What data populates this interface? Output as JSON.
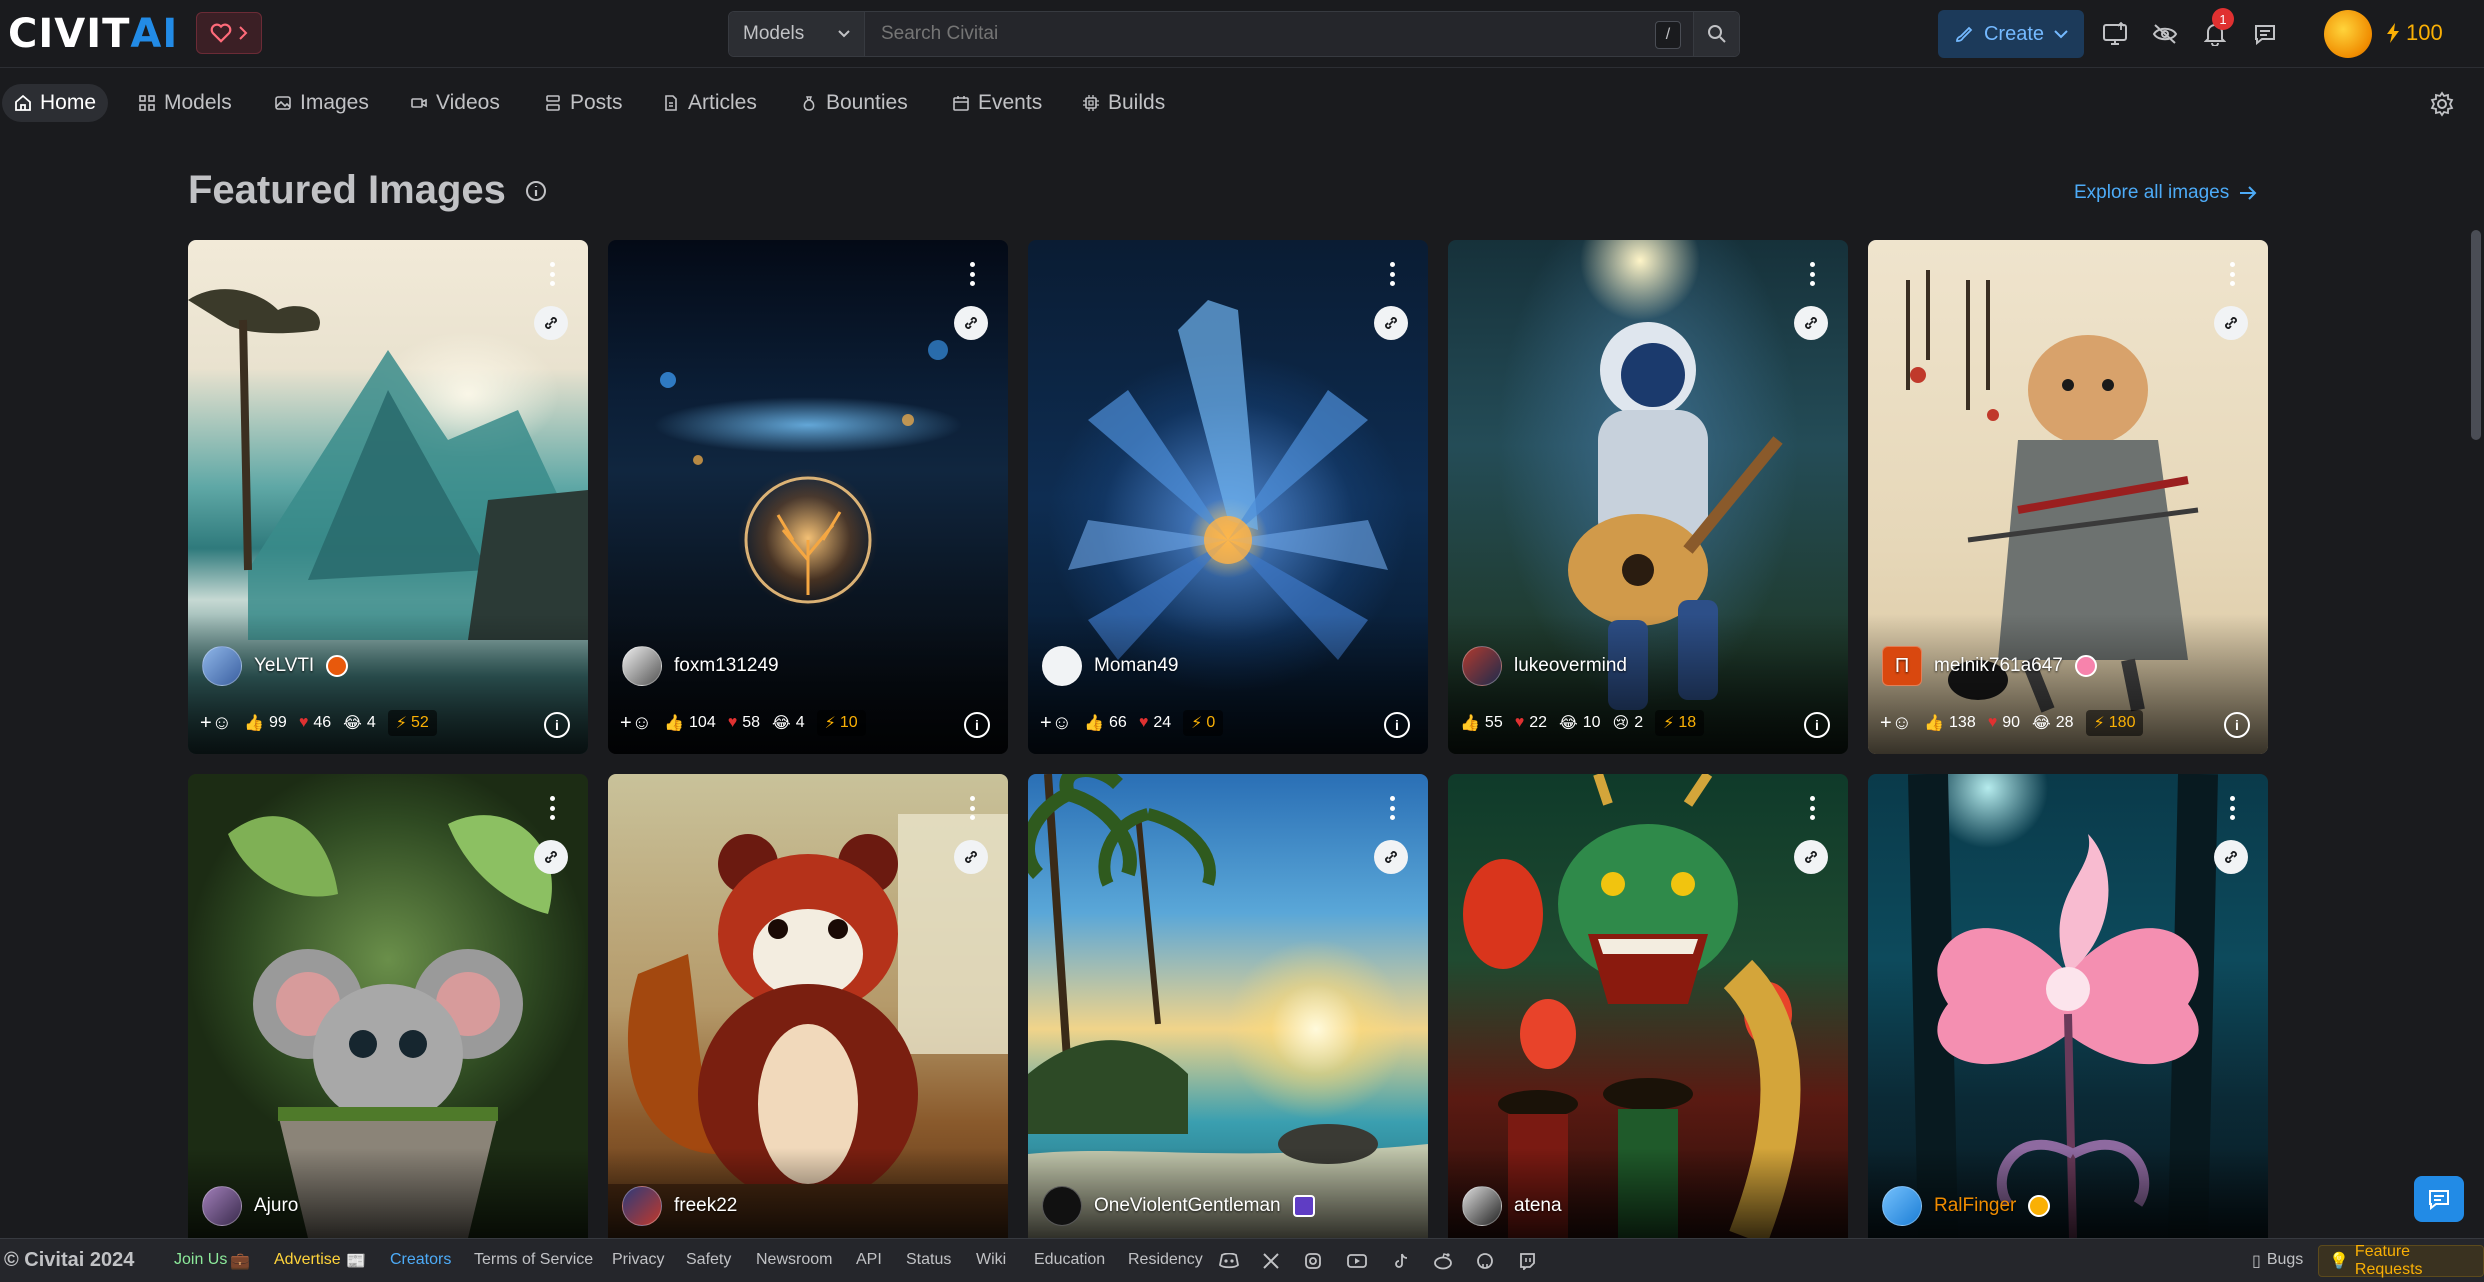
{
  "brand": {
    "part1": "CIVIT",
    "part2": "AI"
  },
  "header": {
    "search_category": "Models",
    "search_placeholder": "Search Civitai",
    "search_shortcut": "/",
    "create_label": "Create",
    "notification_count": "1",
    "buzz_amount": "100"
  },
  "nav": {
    "items": [
      {
        "label": "Home",
        "icon": "home-icon"
      },
      {
        "label": "Models",
        "icon": "grid-icon"
      },
      {
        "label": "Images",
        "icon": "photo-icon"
      },
      {
        "label": "Videos",
        "icon": "video-icon"
      },
      {
        "label": "Posts",
        "icon": "posts-icon"
      },
      {
        "label": "Articles",
        "icon": "article-icon"
      },
      {
        "label": "Bounties",
        "icon": "moneybag-icon"
      },
      {
        "label": "Events",
        "icon": "calendar-icon"
      },
      {
        "label": "Builds",
        "icon": "cpu-icon"
      }
    ]
  },
  "main": {
    "title": "Featured Images",
    "explore_label": "Explore all images"
  },
  "cards": [
    {
      "user": "YeLVTI",
      "like": "99",
      "heart": "46",
      "laugh": "4",
      "cry": "",
      "tip": "52",
      "add": true
    },
    {
      "user": "foxm131249",
      "like": "104",
      "heart": "58",
      "laugh": "4",
      "cry": "",
      "tip": "10",
      "add": true
    },
    {
      "user": "Moman49",
      "like": "66",
      "heart": "24",
      "laugh": "",
      "cry": "",
      "tip": "0",
      "add": true
    },
    {
      "user": "lukeovermind",
      "like": "55",
      "heart": "22",
      "laugh": "10",
      "cry": "2",
      "tip": "18",
      "add": false
    },
    {
      "user": "melnik761a647",
      "like": "138",
      "heart": "90",
      "laugh": "28",
      "cry": "",
      "tip": "180",
      "add": true
    },
    {
      "user": "Ajuro"
    },
    {
      "user": "freek22"
    },
    {
      "user": "OneViolentGentleman"
    },
    {
      "user": "atena"
    },
    {
      "user": "RalFinger"
    }
  ],
  "footer": {
    "copyright": "© Civitai 2024",
    "join": "Join Us",
    "advertise": "Advertise",
    "creators": "Creators",
    "terms": "Terms of Service",
    "privacy": "Privacy",
    "safety": "Safety",
    "newsroom": "Newsroom",
    "api": "API",
    "status": "Status",
    "wiki": "Wiki",
    "education": "Education",
    "residency": "Residency",
    "bugs": "Bugs",
    "feature_requests": "Feature Requests"
  }
}
